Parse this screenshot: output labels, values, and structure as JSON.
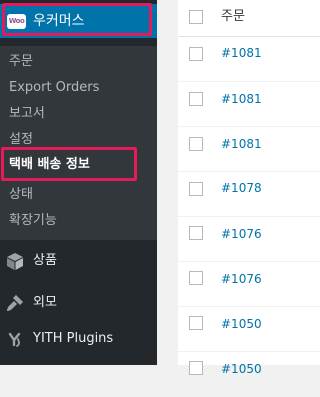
{
  "sidebar": {
    "woocommerce": {
      "logo": "Woo",
      "label": "우커머스"
    },
    "submenu": [
      {
        "label": "주문"
      },
      {
        "label": "Export Orders"
      },
      {
        "label": "보고서"
      },
      {
        "label": "설정"
      },
      {
        "label": "택배 배송 정보",
        "current": true
      },
      {
        "label": "상태"
      },
      {
        "label": "확장기능"
      }
    ],
    "main_items": [
      {
        "label": "상품",
        "icon": "cube-icon"
      },
      {
        "label": "외모",
        "icon": "brush-icon"
      },
      {
        "label": "YITH Plugins",
        "icon": "yith-icon"
      }
    ]
  },
  "table": {
    "header": "주문",
    "rows": [
      "#1081",
      "#1081",
      "#1081",
      "#1078",
      "#1076",
      "#1076",
      "#1050",
      "#1050"
    ]
  },
  "colors": {
    "sidebar_bg": "#23282d",
    "submenu_bg": "#32373c",
    "active_blue": "#0073aa",
    "highlight": "#e6195a",
    "link": "#0073aa"
  }
}
